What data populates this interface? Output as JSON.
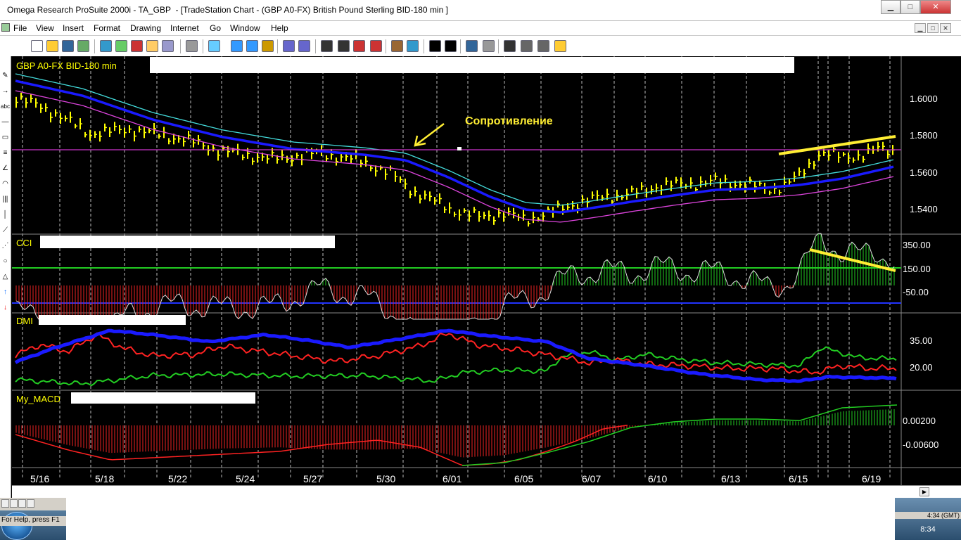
{
  "window": {
    "title": "Omega Research ProSuite 2000i - TA_GBP  - [TradeStation Chart - (GBP A0-FX) British Pound Sterling BID-180 min ]",
    "minimize": "▁",
    "maximize": "□",
    "close": "✕"
  },
  "menu": [
    "File",
    "View",
    "Insert",
    "Format",
    "Drawing",
    "Internet",
    "Go",
    "Window",
    "Help"
  ],
  "mdi_buttons": [
    "▁",
    "□",
    "✕"
  ],
  "chart": {
    "price_pane_title": "GBP A0-FX BID-180 min",
    "cci_title": "CCI",
    "dmi_title": "DMI",
    "macd_title": "My_MACD",
    "annotation": "Сопротивление",
    "price_axis": [
      "1.6000",
      "1.5800",
      "1.5600",
      "1.5400"
    ],
    "cci_axis": [
      "350.00",
      "150.00",
      "-50.00"
    ],
    "dmi_axis": [
      "35.00",
      "20.00"
    ],
    "macd_axis": [
      "0.00200",
      "-0.00600"
    ],
    "dates": [
      "5/16",
      "5/18",
      "5/22",
      "5/24",
      "5/27",
      "5/30",
      "6/01",
      "6/05",
      "6/07",
      "6/10",
      "6/13",
      "6/15",
      "6/19"
    ],
    "colors": {
      "price_bars": "#ffff00",
      "ma_thick": "#1a1aff",
      "ma_upper": "#44dddd",
      "ma_lower": "#dd44dd",
      "resistance": "#cc33cc",
      "cci_level": "#22cc22",
      "cci_floor": "#2233ff",
      "dmi_plus": "#22cc22",
      "dmi_minus": "#ff2222",
      "adx": "#1a1aff",
      "trendline": "#ffee33"
    }
  },
  "status": {
    "left_text": "For Help, press F1",
    "right_text": "4:34 (GMT)",
    "clock": "8:34"
  },
  "icons": [
    "new-file-icon",
    "open-folder-icon",
    "save-icon",
    "print-icon",
    "zoom-in-icon",
    "zoom-out-icon",
    "pointer-icon",
    "windows-start-icon"
  ]
}
